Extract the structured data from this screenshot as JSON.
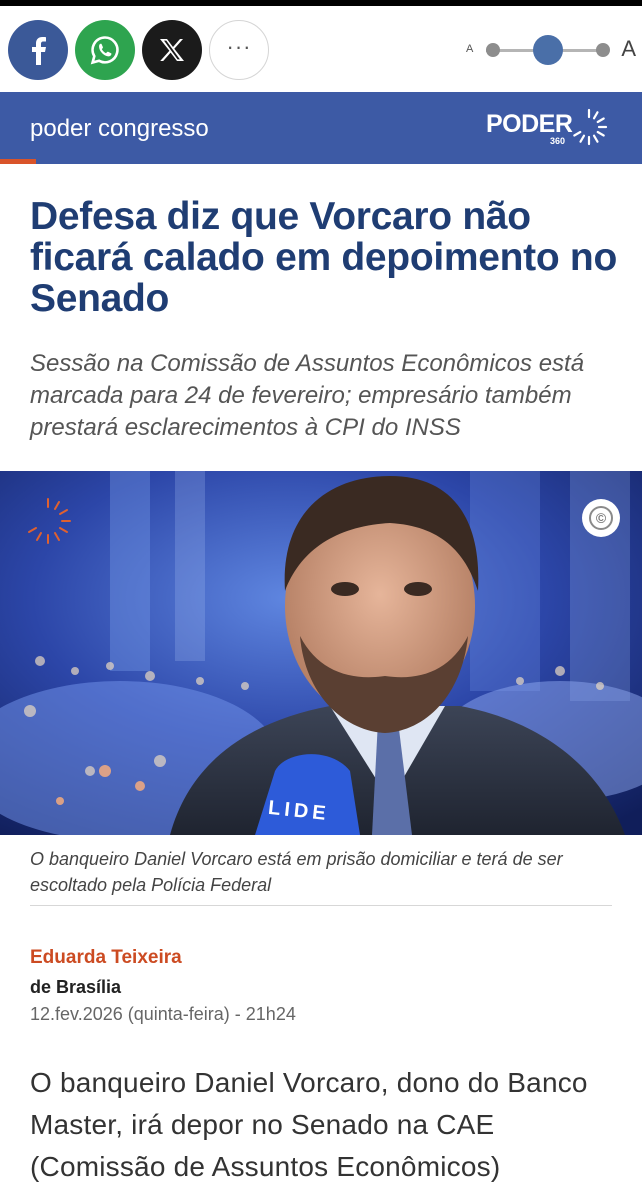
{
  "share": {
    "facebook_icon": "facebook-icon",
    "whatsapp_icon": "whatsapp-icon",
    "x_icon": "x-icon",
    "more_label": "···"
  },
  "font_size": {
    "small_label": "A",
    "large_label": "A",
    "level": 0.5
  },
  "section": {
    "label": "poder congresso",
    "logo_text": "PODER",
    "logo_sub": "360"
  },
  "article": {
    "headline": "Defesa diz que Vorcaro não ficará calado em depoimento no Senado",
    "subtitle": "Sessão na Comissão de Assuntos Econômicos está marcada para 24 de fevereiro; empresário também prestará esclarecimentos à CPI do INSS",
    "photo": {
      "mic_text": "LIDE",
      "copyright_symbol": "©"
    },
    "caption": "O banqueiro Daniel Vorcaro está em prisão domiciliar e terá de ser escoltado pela Polícia Federal",
    "author": "Eduarda Teixeira",
    "location": "de Brasília",
    "date": "12.fev.2026 (quinta-feira) - 21h24",
    "body": "O banqueiro Daniel Vorcaro, dono do Banco Master, irá depor no Senado na CAE (Comissão de Assuntos Econômicos)"
  },
  "colors": {
    "section_bg": "#3d5aa5",
    "accent": "#d9542a",
    "headline": "#1f3d73",
    "author": "#cc4b22"
  }
}
